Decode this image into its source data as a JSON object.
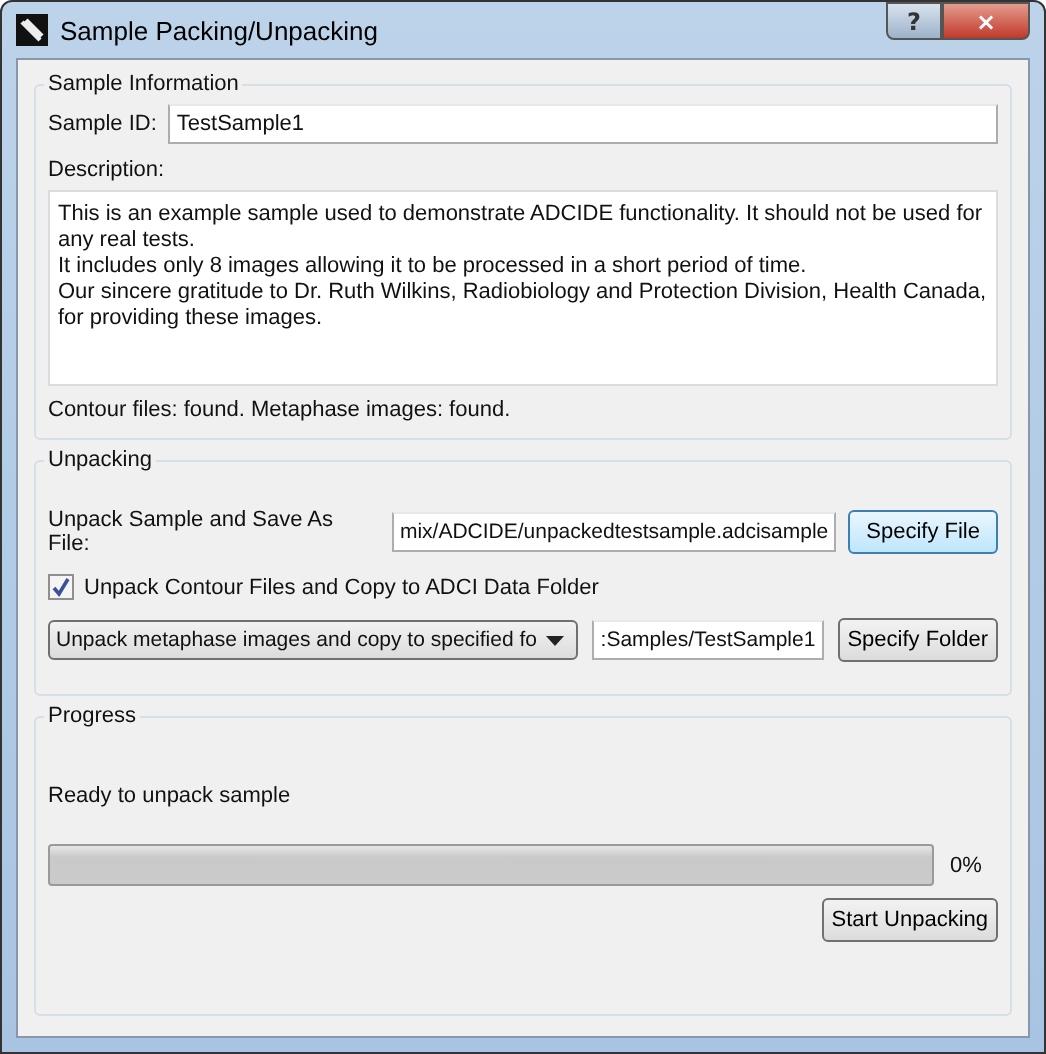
{
  "window": {
    "title": "Sample Packing/Unpacking",
    "buttons": [
      "?",
      "×"
    ]
  },
  "sample_information": {
    "title": "Sample Information",
    "sample_id_label": "Sample ID:",
    "sample_id": "TestSample1",
    "description_label": "Description:",
    "description": [
      "This is an example sample used to demonstrate ADCIDE functionality. It should not be used for any real tests.",
      "It includes only 8 images allowing it to be processed in a short period of time.",
      "Our sincere gratitude to Dr. Ruth Wilkins, Radiobiology and Protection Division, Health Canada, for providing these images."
    ],
    "status": "Contour files: found. Metaphase images: found."
  },
  "unpacking": {
    "title": "Unpacking",
    "file_label": "Unpack Sample and Save As File:",
    "file_path": "mix/ADCIDE/unpackedtestsample.adcisample",
    "file_button": "Specify File",
    "contour_checkbox": {
      "label": "Unpack Contour Files and Copy to ADCI Data Folder",
      "checked": true
    },
    "images_mode": "Unpack metaphase images and copy to specified fo",
    "folder_path": ":Samples/TestSample1",
    "folder_button": "Specify Folder"
  },
  "progress": {
    "title": "Progress",
    "status": "Ready to unpack sample",
    "level": 0,
    "percent": "0%",
    "start_button": "Start Unpacking"
  }
}
